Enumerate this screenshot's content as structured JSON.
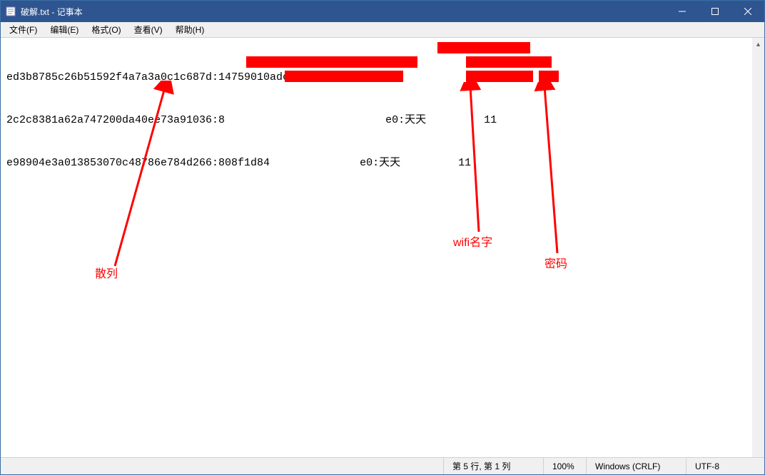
{
  "window": {
    "title": "破解.txt - 记事本"
  },
  "menu": {
    "file": "文件(F)",
    "edit": "编辑(E)",
    "format": "格式(O)",
    "view": "查看(V)",
    "help": "帮助(H)"
  },
  "content": {
    "lines": [
      "ed3b8785c26b51592f4a7a3a0c1c687d:14759010adc2:b8ee65077f4d:2:           37",
      "2c2c8381a62a747200da40ee73a91036:8                         e0:天天         11",
      "e98904e3a013853070c48786e784d266:808f1d84              e0:天天         11"
    ]
  },
  "annotations": {
    "hash_label": "散列",
    "wifi_label": "wifi名字",
    "password_label": "密码"
  },
  "statusbar": {
    "position": "第 5 行, 第 1 列",
    "zoom": "100%",
    "line_ending": "Windows (CRLF)",
    "encoding": "UTF-8"
  }
}
